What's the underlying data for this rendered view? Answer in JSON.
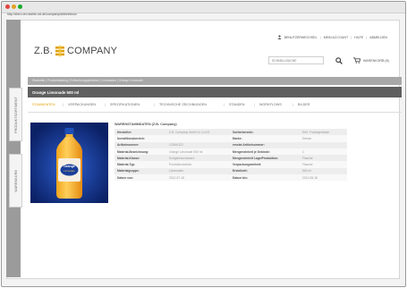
{
  "browser": {
    "url": "http://zbm-rvm.stahle-xxl.de/company/artikel/show"
  },
  "sidebar_tabs": [
    {
      "label": "PRODUKTSORTIMENT"
    },
    {
      "label": "WARENKORB"
    }
  ],
  "header": {
    "logo_left": "Z.B.",
    "logo_right": "COMPANY",
    "nav": [
      "BENUTZERWECHSEL",
      "MEIN ACCOUNT",
      "HILFE",
      "ABMELDEN"
    ],
    "search_placeholder": "SCHNELLSUCHE",
    "cart_label": "WARENKORB (8)"
  },
  "breadcrumb": "Startseite | Produktkatalog | Erfrischungsgetränke | Limonaden | Orange Limonade",
  "product": {
    "title": "Orange Limonade 500 ml",
    "label_top": "Orange",
    "label_bottom": "Limonade"
  },
  "tabs": [
    {
      "label": "STAMMDATEN",
      "active": true
    },
    {
      "label": "VERPACKUNGEN",
      "active": false
    },
    {
      "label": "SPEZIFIKATIONEN",
      "active": false
    },
    {
      "label": "TECHNISCHE ZEICHNUNGEN",
      "active": false
    },
    {
      "label": "STANDEN",
      "active": false
    },
    {
      "label": "WORKFLOWS",
      "active": false
    },
    {
      "label": "BILDER",
      "active": false
    }
  ],
  "spec": {
    "title": "WARENSTAMMDATEN (Z.B. Company)",
    "rows": [
      {
        "l1": "Hersteller:",
        "v1": "Z.B. Company GmbH & Co.KG",
        "l2": "Sortierbereich:",
        "v2": "Erfri. Fruchtgetränke"
      },
      {
        "l1": "Investitionsbereich:",
        "v1": "",
        "l2": "Marke:",
        "v2": "Deluxe"
      },
      {
        "l1": "Artikelnummer:",
        "v1": "12345/323",
        "l2": "ersetzt Artikelnummer:",
        "v2": ""
      },
      {
        "l1": "Material-Bezeichnung:",
        "v1": "Orange Limonade 500 ml",
        "l2": "Mengeneinheit je Gebinde:",
        "v2": "1"
      },
      {
        "l1": "Material-Klasse:",
        "v1": "Endgebrauchsware",
        "l2": "Mengeneinheit Lage/Produktion:",
        "v2": "Flasche"
      },
      {
        "l1": "Material-Typ:",
        "v1": "Produktionsstück",
        "l2": "Verpackungseinheit:",
        "v2": "Flasche"
      },
      {
        "l1": "Materialgruppe:",
        "v1": "Limonaden",
        "l2": "Erstellzeit:",
        "v2": "500 ml"
      },
      {
        "l1": "Datum von:",
        "v1": "2012-07-18",
        "l2": "Datum bis:",
        "v2": "2012-08-18"
      }
    ]
  },
  "colors": {
    "accent": "#e0a000",
    "title_bar": "#5f5f5f",
    "crumb_bar": "#a8a8a8",
    "product_bg": "#0e2a7a"
  }
}
